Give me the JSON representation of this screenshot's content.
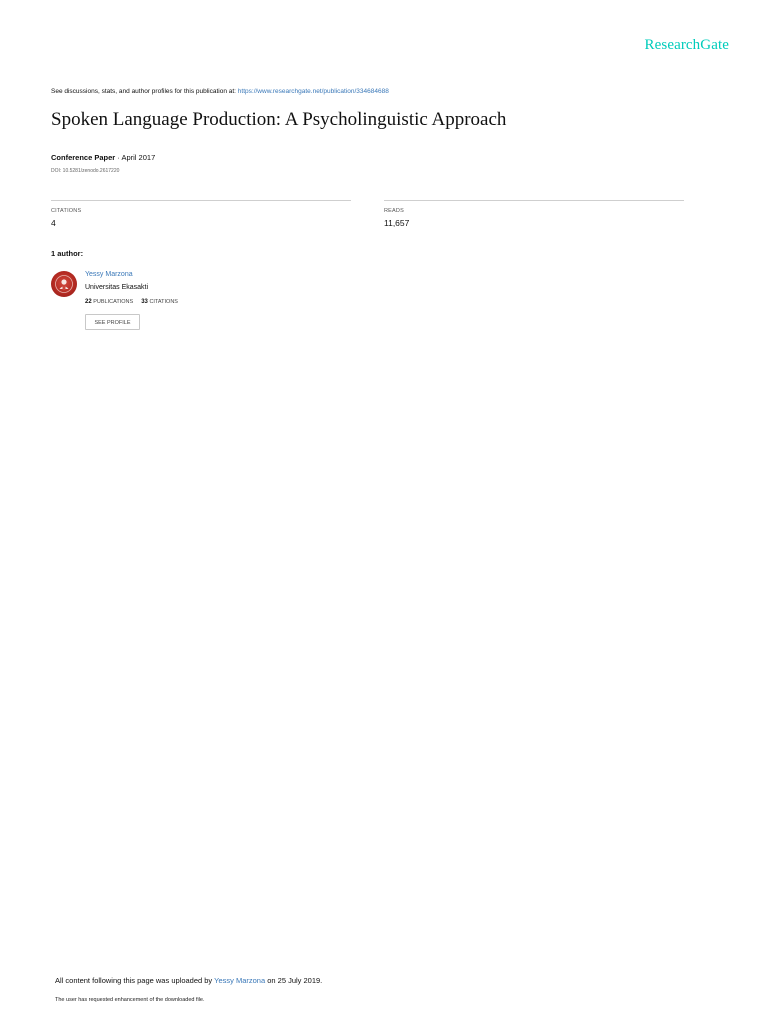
{
  "brand": {
    "name": "ResearchGate",
    "color": "#00ccbb"
  },
  "intro": {
    "text": "See discussions, stats, and author profiles for this publication at: ",
    "link": "https://www.researchgate.net/publication/334684688"
  },
  "publication": {
    "title": "Spoken Language Production: A Psycholinguistic Approach",
    "type": "Conference Paper",
    "separator": " · ",
    "date": "April 2017",
    "doi": "DOI: 10.5281/zenodo.2617220"
  },
  "stats": {
    "citations_label": "CITATIONS",
    "citations_value": "4",
    "reads_label": "READS",
    "reads_value": "11,657"
  },
  "authors": {
    "heading": "1 author:",
    "list": [
      {
        "name": "Yessy Marzona",
        "institution": "Universitas Ekasakti",
        "publications_count": "22",
        "publications_label": "PUBLICATIONS",
        "citations_count": "33",
        "citations_label": "CITATIONS",
        "button_label": "SEE PROFILE",
        "avatar_icon": "university-seal-avatar"
      }
    ]
  },
  "footer": {
    "uploaded_prefix": "All content following this page was uploaded by ",
    "uploader": "Yessy Marzona",
    "uploaded_suffix": " on 25 July 2019.",
    "note": "The user has requested enhancement of the downloaded file."
  },
  "colors": {
    "link": "#3a78b8",
    "divider": "#cfcfcf",
    "avatar": "#b32a22"
  }
}
